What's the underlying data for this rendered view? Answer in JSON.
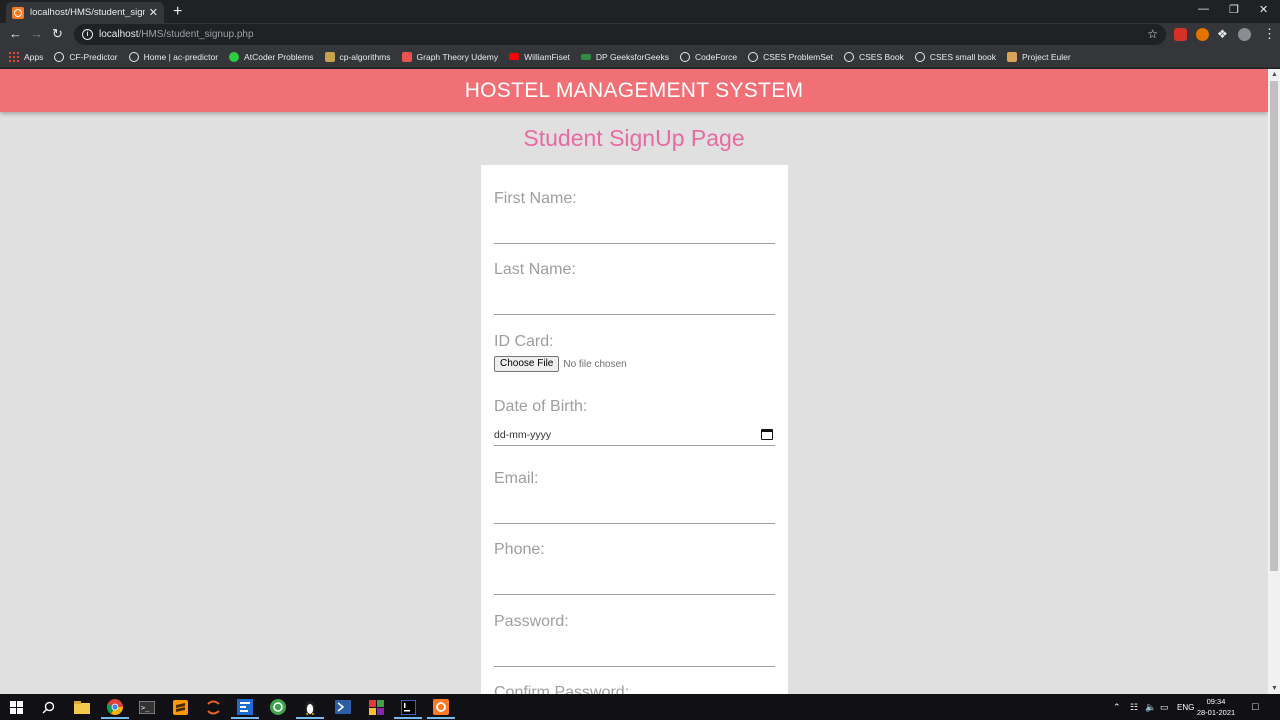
{
  "browser": {
    "tab_title": "localhost/HMS/student_signup.p",
    "tab_close": "✕",
    "new_tab": "+",
    "url_host": "localhost",
    "url_path": "/HMS/student_signup.php",
    "window_minimize": "—",
    "window_restore": "❐",
    "window_close": "✕"
  },
  "bookmarks": [
    {
      "label": "Apps",
      "icon": "apps-grid-icon",
      "color": "#ea4335"
    },
    {
      "label": "CF-Predictor",
      "icon": "globe-icon",
      "color": "#e8eaed"
    },
    {
      "label": "Home | ac-predictor",
      "icon": "globe-icon",
      "color": "#e8eaed"
    },
    {
      "label": "AtCoder Problems",
      "icon": "atcoder-icon",
      "color": "#2ecc40"
    },
    {
      "label": "cp-algorithms",
      "icon": "cp-algorithms-icon",
      "color": "#c8a24a"
    },
    {
      "label": "Graph Theory Udemy",
      "icon": "udemy-icon",
      "color": "#ec5252"
    },
    {
      "label": "WilliamFiset",
      "icon": "youtube-icon",
      "color": "#ff0000"
    },
    {
      "label": "DP GeeksforGeeks",
      "icon": "gfg-icon",
      "color": "#2f8d46"
    },
    {
      "label": "CodeForce",
      "icon": "globe-icon",
      "color": "#e8eaed"
    },
    {
      "label": "CSES ProblemSet",
      "icon": "globe-icon",
      "color": "#e8eaed"
    },
    {
      "label": "CSES Book",
      "icon": "globe-icon",
      "color": "#e8eaed"
    },
    {
      "label": "CSES small book",
      "icon": "globe-icon",
      "color": "#e8eaed"
    },
    {
      "label": "Project Euler",
      "icon": "project-euler-icon",
      "color": "#d9a35a"
    }
  ],
  "page": {
    "header_title": "HOSTEL MANAGEMENT SYSTEM",
    "heading": "Student SignUp Page",
    "header_color": "#f07076",
    "heading_color": "#e96aa3"
  },
  "form": {
    "first_name_label": "First Name:",
    "last_name_label": "Last Name:",
    "id_card_label": "ID Card:",
    "choose_file_label": "Choose File",
    "no_file_text": "No file chosen",
    "dob_label": "Date of Birth:",
    "dob_placeholder": "dd-mm-yyyy",
    "email_label": "Email:",
    "phone_label": "Phone:",
    "password_label": "Password:",
    "confirm_password_label": "Confirm Password:"
  },
  "taskbar": {
    "language": "ENG",
    "time": "09:34",
    "date": "28-01-2021"
  }
}
